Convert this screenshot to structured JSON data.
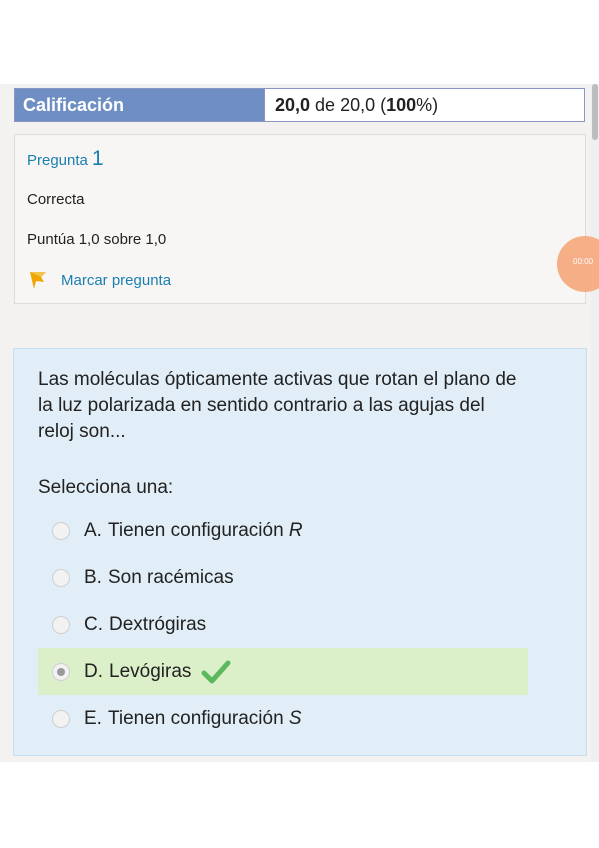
{
  "grade": {
    "label": "Calificación",
    "value": "20,0 de 20,0 (100%)"
  },
  "question_info": {
    "heading": "Pregunta",
    "number": "1",
    "state": "Correcta",
    "score": "Puntúa 1,0 sobre 1,0",
    "flag_label": "Marcar pregunta",
    "flag_color": "#f0a400"
  },
  "timer": {
    "text": "00:00"
  },
  "question": {
    "text": "Las moléculas ópticamente activas que rotan el plano de la luz polarizada en sentido contrario a las agujas del reloj son...",
    "prompt": "Selecciona una:",
    "answers": [
      {
        "letter": "A.",
        "text": "Tienen configuración ",
        "italic": "R",
        "selected": false,
        "correct": false
      },
      {
        "letter": "B.",
        "text": "Son racémicas",
        "italic": "",
        "selected": false,
        "correct": false
      },
      {
        "letter": "C.",
        "text": "Dextrógiras",
        "italic": "",
        "selected": false,
        "correct": false
      },
      {
        "letter": "D.",
        "text": "Levógiras",
        "italic": "",
        "selected": true,
        "correct": true
      },
      {
        "letter": "E.",
        "text": "Tienen configuración ",
        "italic": "S",
        "selected": false,
        "correct": false
      }
    ],
    "correct_color": "#5cb85c"
  }
}
